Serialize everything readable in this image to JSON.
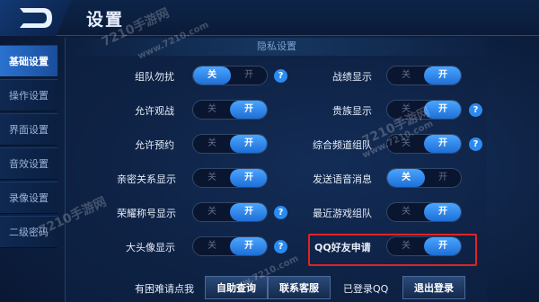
{
  "header": {
    "title": "设置",
    "logo_icon": "d-logo-icon"
  },
  "sidebar": {
    "items": [
      {
        "label": "基础设置",
        "active": true
      },
      {
        "label": "操作设置",
        "active": false
      },
      {
        "label": "界面设置",
        "active": false
      },
      {
        "label": "音效设置",
        "active": false
      },
      {
        "label": "录像设置",
        "active": false
      },
      {
        "label": "二级密码",
        "active": false
      }
    ]
  },
  "section": {
    "title": "隐私设置"
  },
  "toggle_text": {
    "off": "关",
    "on": "开"
  },
  "settings": {
    "team_dnd": {
      "label": "组队勿扰",
      "value": "off",
      "help": "?"
    },
    "record_show": {
      "label": "战绩显示",
      "value": "on"
    },
    "allow_spectate": {
      "label": "允许观战",
      "value": "on"
    },
    "noble_show": {
      "label": "贵族显示",
      "value": "on",
      "help": "?"
    },
    "allow_reserve": {
      "label": "允许预约",
      "value": "on"
    },
    "channel_team": {
      "label": "综合频道组队",
      "value": "on",
      "help": "?"
    },
    "intimate_show": {
      "label": "亲密关系显示",
      "value": "on"
    },
    "voice_msg": {
      "label": "发送语音消息",
      "value": "off"
    },
    "honor_title": {
      "label": "荣耀称号显示",
      "value": "on",
      "help": "?"
    },
    "recent_team": {
      "label": "最近游戏组队",
      "value": "on"
    },
    "avatar_show": {
      "label": "大头像显示",
      "value": "on",
      "help": "?"
    },
    "qq_friend": {
      "label": "QQ好友申请",
      "value": "on"
    }
  },
  "footer": {
    "help_text": "有困难请点我",
    "self_query": "自助查询",
    "contact": "联系客服",
    "logged_in": "已登录QQ",
    "logout": "退出登录"
  },
  "watermark": {
    "text": "7210手游网",
    "url": "www.7210.com"
  },
  "colors": {
    "accent": "#2b8bf0",
    "highlight": "#e02424",
    "bg": "#0b1a36"
  }
}
